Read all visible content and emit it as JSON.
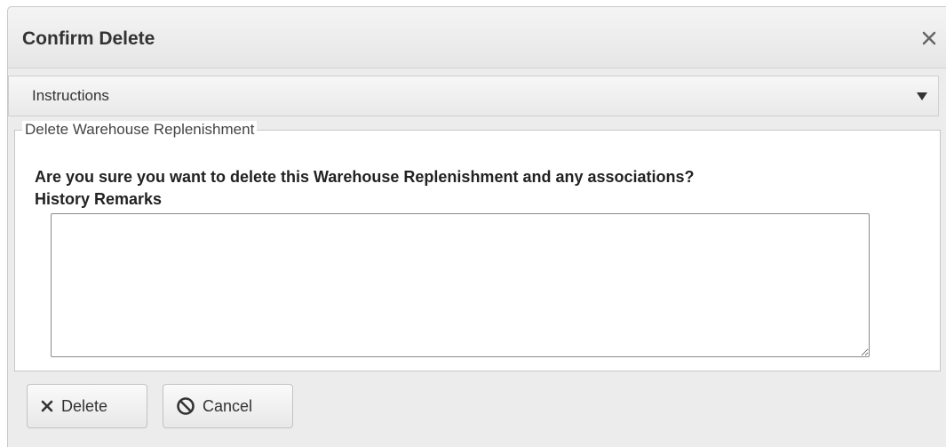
{
  "dialog": {
    "title": "Confirm Delete",
    "close_icon": "close-icon"
  },
  "instructions": {
    "label": "Instructions",
    "toggle_icon": "caret-down-icon"
  },
  "section": {
    "legend": "Delete Warehouse Replenishment",
    "question": "Are you sure you want to delete this Warehouse Replenishment and any associations?",
    "remarks_label": "History Remarks",
    "remarks_value": ""
  },
  "buttons": {
    "delete_label": "Delete",
    "delete_icon": "x-icon",
    "cancel_label": "Cancel",
    "cancel_icon": "ban-icon"
  }
}
